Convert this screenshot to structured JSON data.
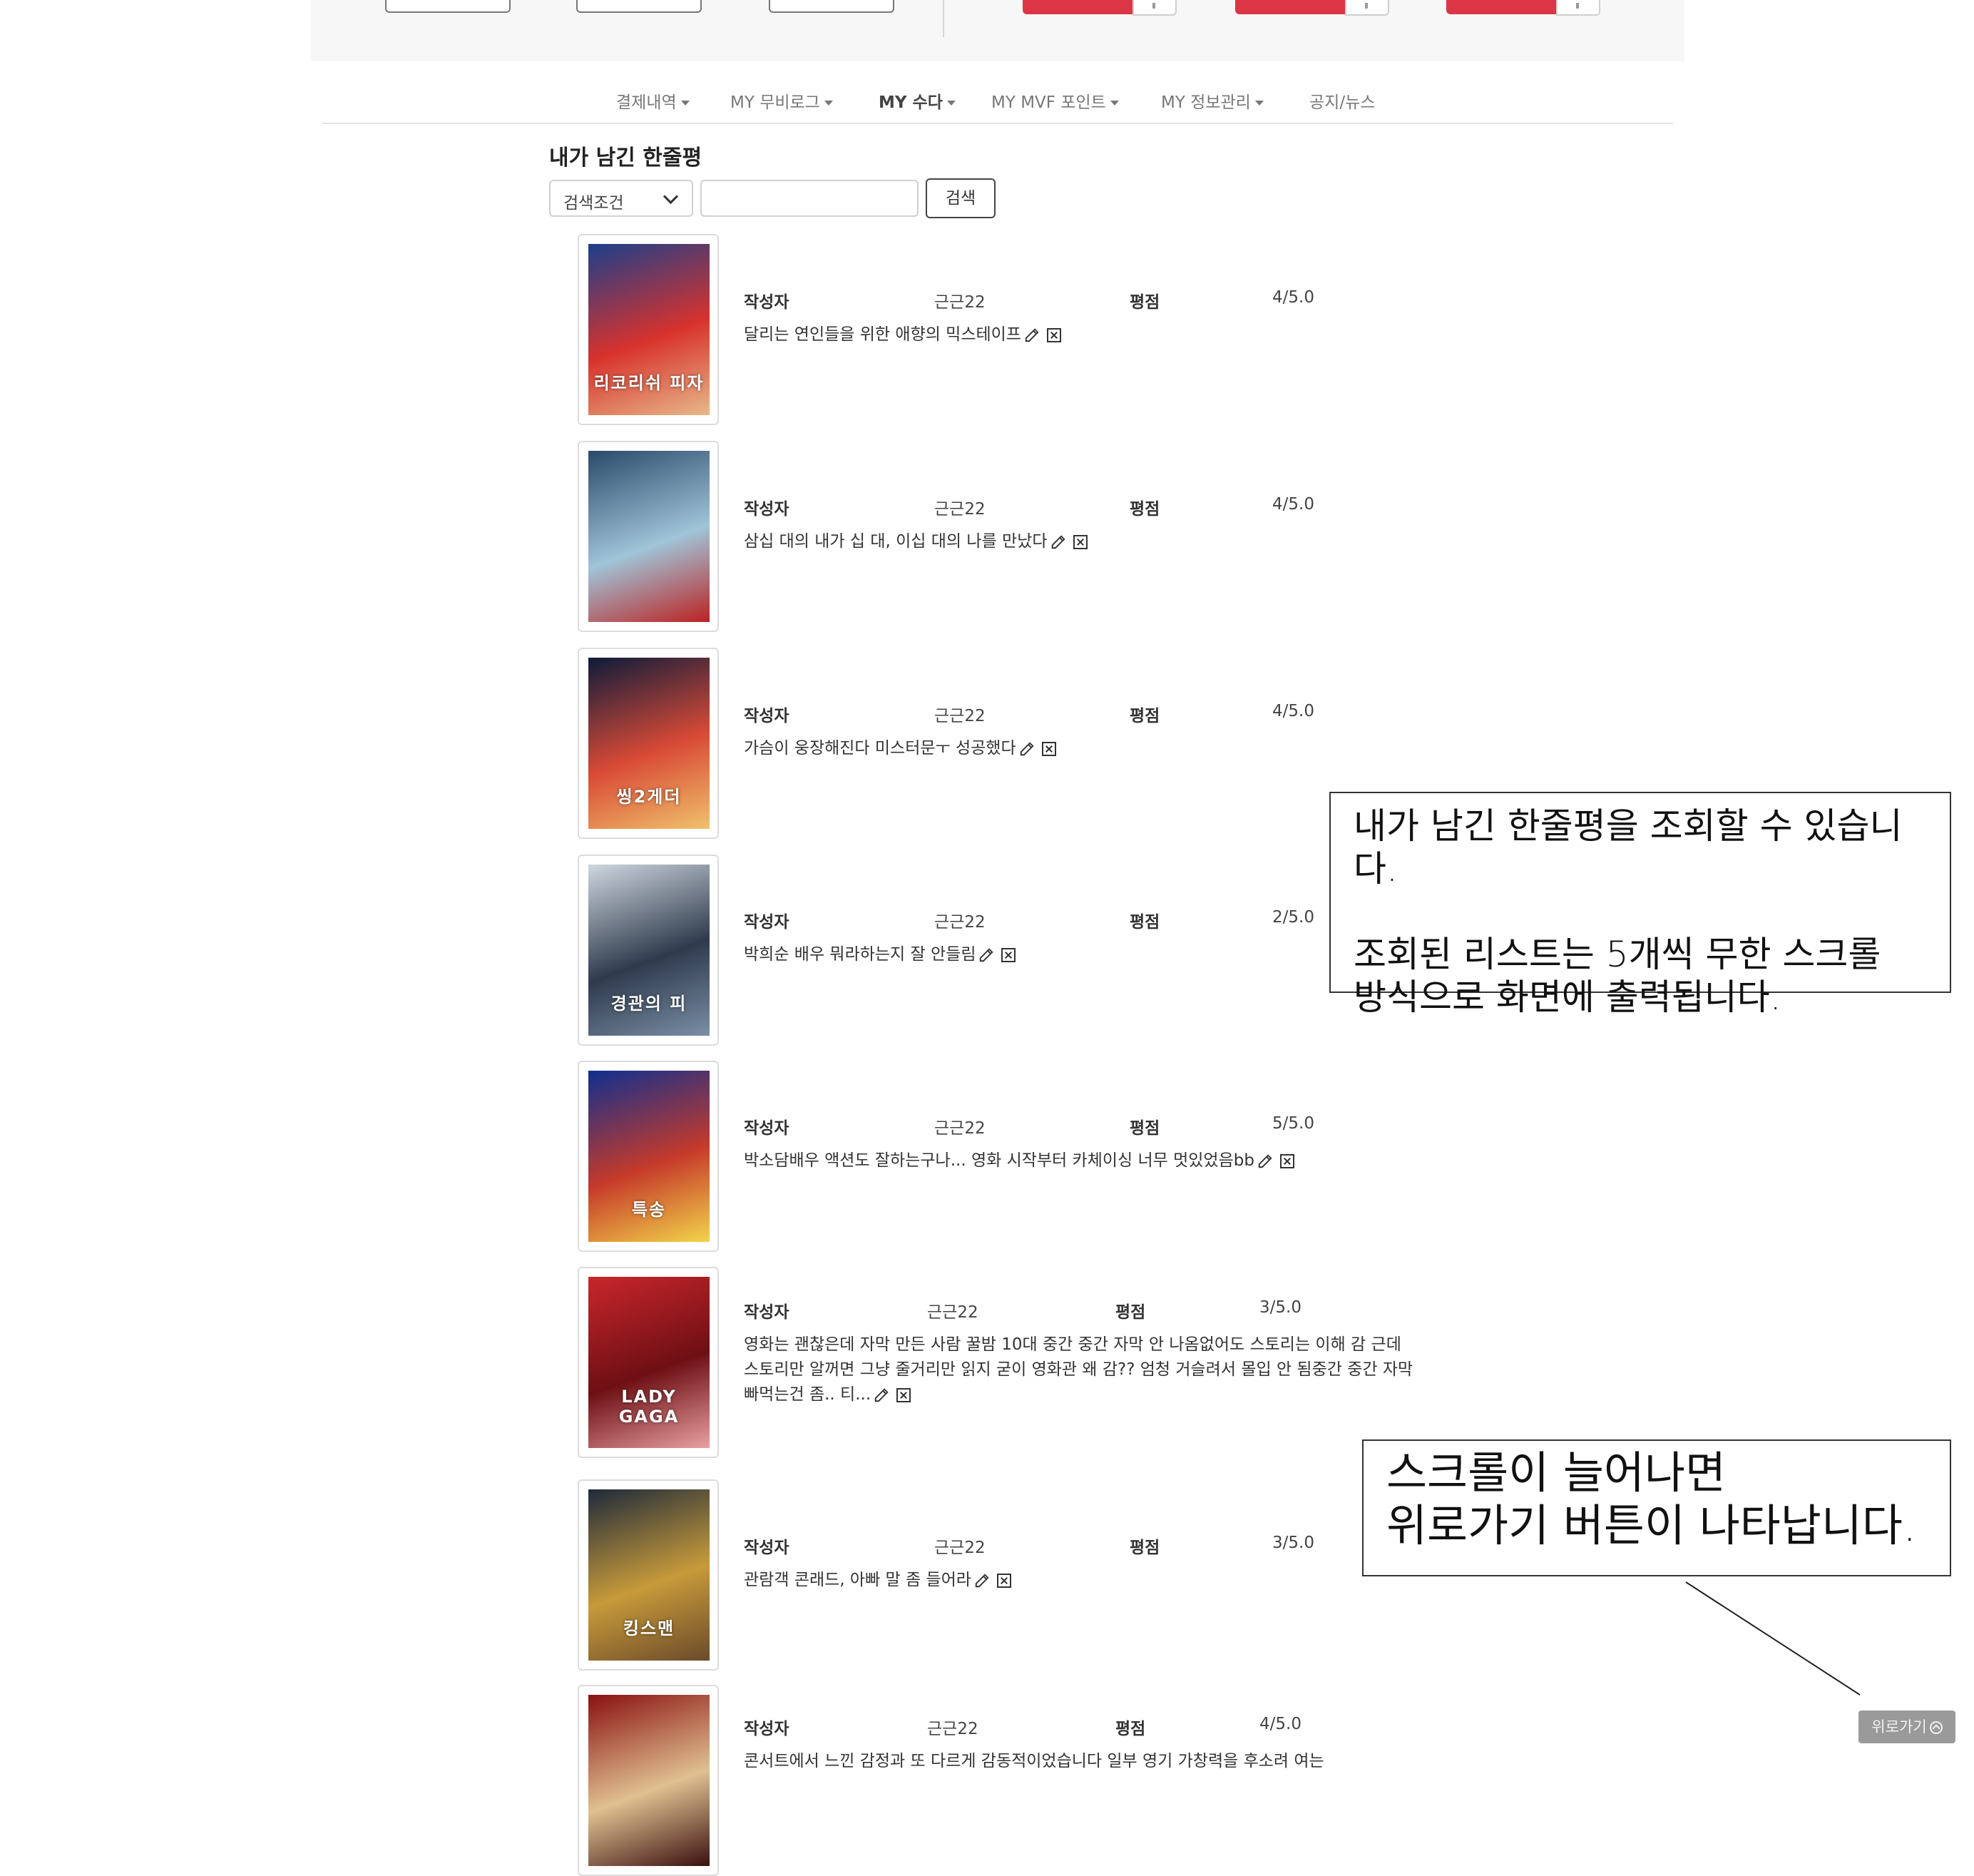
{
  "nav": {
    "items": [
      {
        "label": "결제내역",
        "dropdown": true,
        "active": false
      },
      {
        "label": "MY 무비로그",
        "dropdown": true,
        "active": false
      },
      {
        "label": "MY 수다",
        "dropdown": true,
        "active": true
      },
      {
        "label": "MY MVF 포인트",
        "dropdown": true,
        "active": false
      },
      {
        "label": "MY 정보관리",
        "dropdown": true,
        "active": false
      },
      {
        "label": "공지/뉴스",
        "dropdown": false,
        "active": false
      }
    ]
  },
  "section_title": "내가 남긴 한줄평",
  "search": {
    "select_value": "검색조건",
    "input_value": "",
    "button_label": "검색"
  },
  "labels": {
    "author": "작성자",
    "rating": "평점"
  },
  "reviews": [
    {
      "author": "근근22",
      "rating": "4/5.0",
      "text": "달리는 연인들을 위한 애향의 믹스테이프"
    },
    {
      "author": "근근22",
      "rating": "4/5.0",
      "text": "삼십 대의 내가 십 대, 이십 대의 나를 만났다"
    },
    {
      "author": "근근22",
      "rating": "4/5.0",
      "text": "가슴이 웅장해진다 미스터문ㅜ 성공했다"
    },
    {
      "author": "근근22",
      "rating": "2/5.0",
      "text": "박희순 배우 뭐라하는지 잘 안들림"
    },
    {
      "author": "근근22",
      "rating": "5/5.0",
      "text": "박소담배우 액션도 잘하는구나... 영화 시작부터 카체이싱 너무 멋있었음bb"
    },
    {
      "author": "근근22",
      "rating": "3/5.0",
      "text": "영화는 괜찮은데 자막 만든 사람 꿀밤 10대 중간 중간 자막 안 나옴없어도 스토리는 이해 감 근데 스토리만 알꺼면 그냥 줄거리만 읽지 굳이 영화관 왜 감?? 엄청 거슬려서 몰입 안 됨중간 중간 자막 빠먹는건 좀.. 티..."
    },
    {
      "author": "근근22",
      "rating": "3/5.0",
      "text": "관람객 콘래드, 아빠 말 좀 들어라"
    },
    {
      "author": "근근22",
      "rating": "4/5.0",
      "text": "콘서트에서 느낀 감정과 또 다르게 감동적이었습니다 일부 영기 가창력을 후소려 여는"
    }
  ],
  "posters": [
    {
      "icon": "poster-licorice-pizza",
      "colors": [
        "#1b3f8a",
        "#d8322c",
        "#e7b98a"
      ],
      "caption": "리코리쉬 피자"
    },
    {
      "icon": "poster-spiderman",
      "colors": [
        "#2a4a6a",
        "#a0c4d8",
        "#b22"
      ],
      "caption": ""
    },
    {
      "icon": "poster-minions",
      "colors": [
        "#0d1b3a",
        "#d94a36",
        "#f0c26b"
      ],
      "caption": "씽2게더"
    },
    {
      "icon": "poster-drama-men",
      "colors": [
        "#cfd7df",
        "#2f3b4d",
        "#7a8ea6"
      ],
      "caption": "경관의 피"
    },
    {
      "icon": "poster-special-delivery",
      "colors": [
        "#0f2f8f",
        "#c63a2a",
        "#f2d44a"
      ],
      "caption": "특송"
    },
    {
      "icon": "poster-house-of-gucci",
      "colors": [
        "#c9262b",
        "#6e0f14",
        "#e8a0a0"
      ],
      "caption": "LADY GAGA"
    },
    {
      "icon": "poster-kingsman",
      "colors": [
        "#1e2a3a",
        "#c79a3a",
        "#6b4a2a"
      ],
      "caption": "킹스맨"
    },
    {
      "icon": "poster-concert",
      "colors": [
        "#8a1010",
        "#e0c090",
        "#3a1010"
      ],
      "caption": ""
    }
  ],
  "annotations": {
    "note1": [
      "내가 남긴 한줄평을 조회할 수 있습니다.",
      "",
      "조회된 리스트는 5개씩 무한 스크롤",
      "방식으로 화면에 출력됩니다."
    ],
    "note2": [
      "스크롤이 늘어나면",
      "위로가기 버튼이 나타납니다."
    ]
  },
  "top_button_label": "위로가기",
  "colors": {
    "accent_red": "#dc3545",
    "header_bg": "#f7f7f8",
    "top_button_bg": "#9a9a9a"
  }
}
